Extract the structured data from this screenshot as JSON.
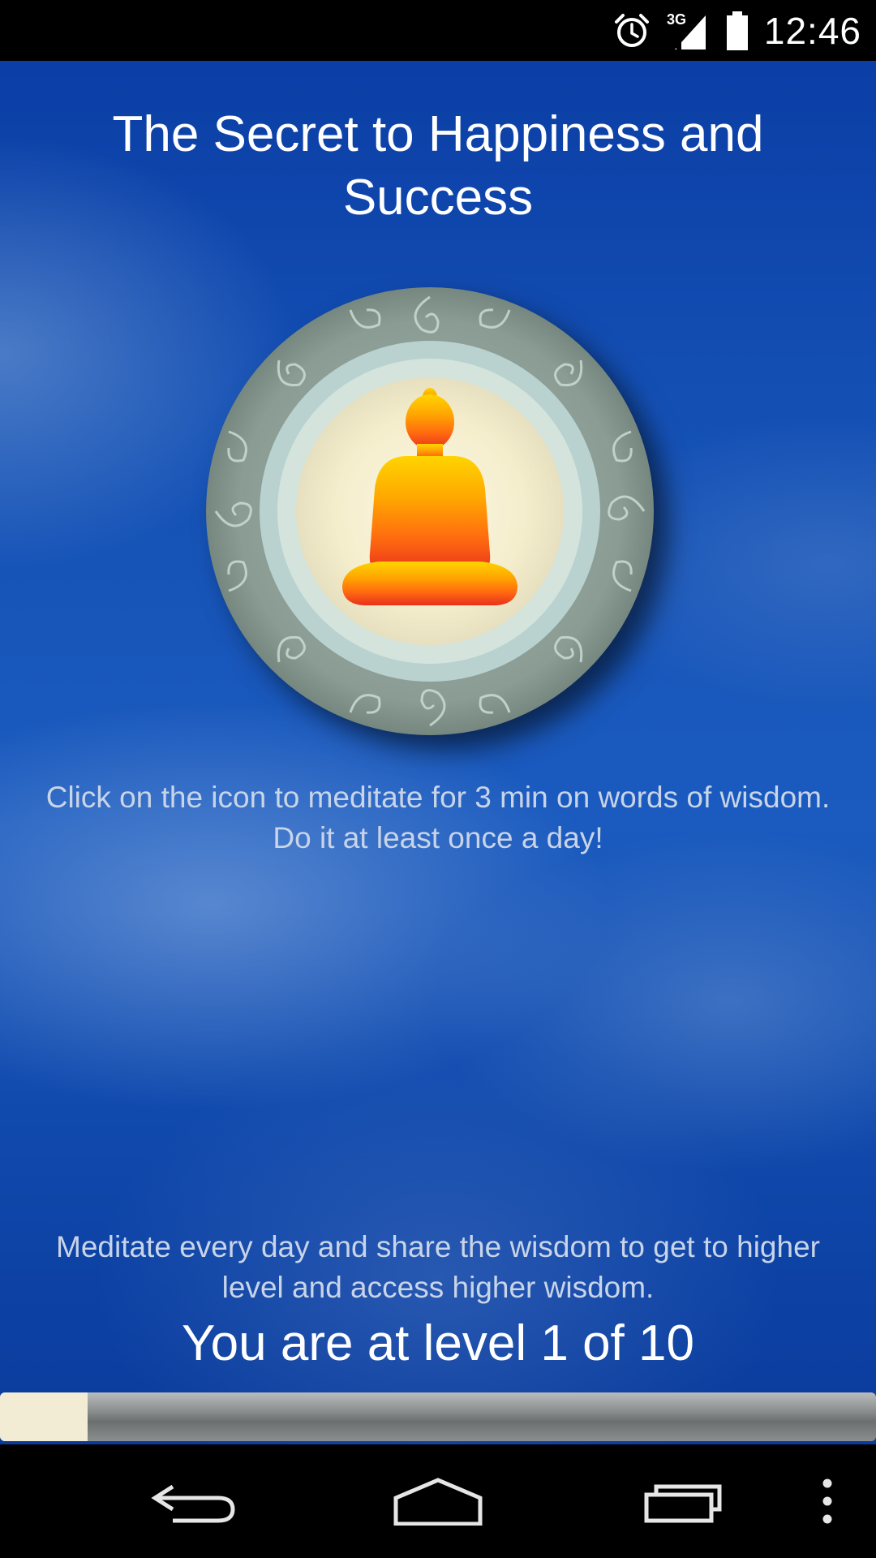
{
  "status_bar": {
    "time": "12:46",
    "network": "3G",
    "icons": [
      "alarm-icon",
      "signal-icon",
      "battery-icon"
    ]
  },
  "main": {
    "title": "The Secret to Happiness and Success",
    "meditate_icon": "meditating-buddha-icon",
    "instruction": "Click on the icon to meditate for 3 min on  words of wisdom. Do it at least once a day!",
    "levels_info": "Meditate every day and share the wisdom to get to higher level and access higher wisdom.",
    "level_label": "You are at level 1 of 10",
    "level_current": 1,
    "level_total": 10
  },
  "nav_bar": {
    "buttons": [
      "back-icon",
      "home-icon",
      "recents-icon",
      "overflow-menu-icon"
    ]
  },
  "colors": {
    "background_blue": "#1450b4",
    "title_text": "#ffffff",
    "body_text": "#c8d4e8",
    "progress_fill": "#f2ecd4",
    "progress_track": "#8e9292"
  }
}
